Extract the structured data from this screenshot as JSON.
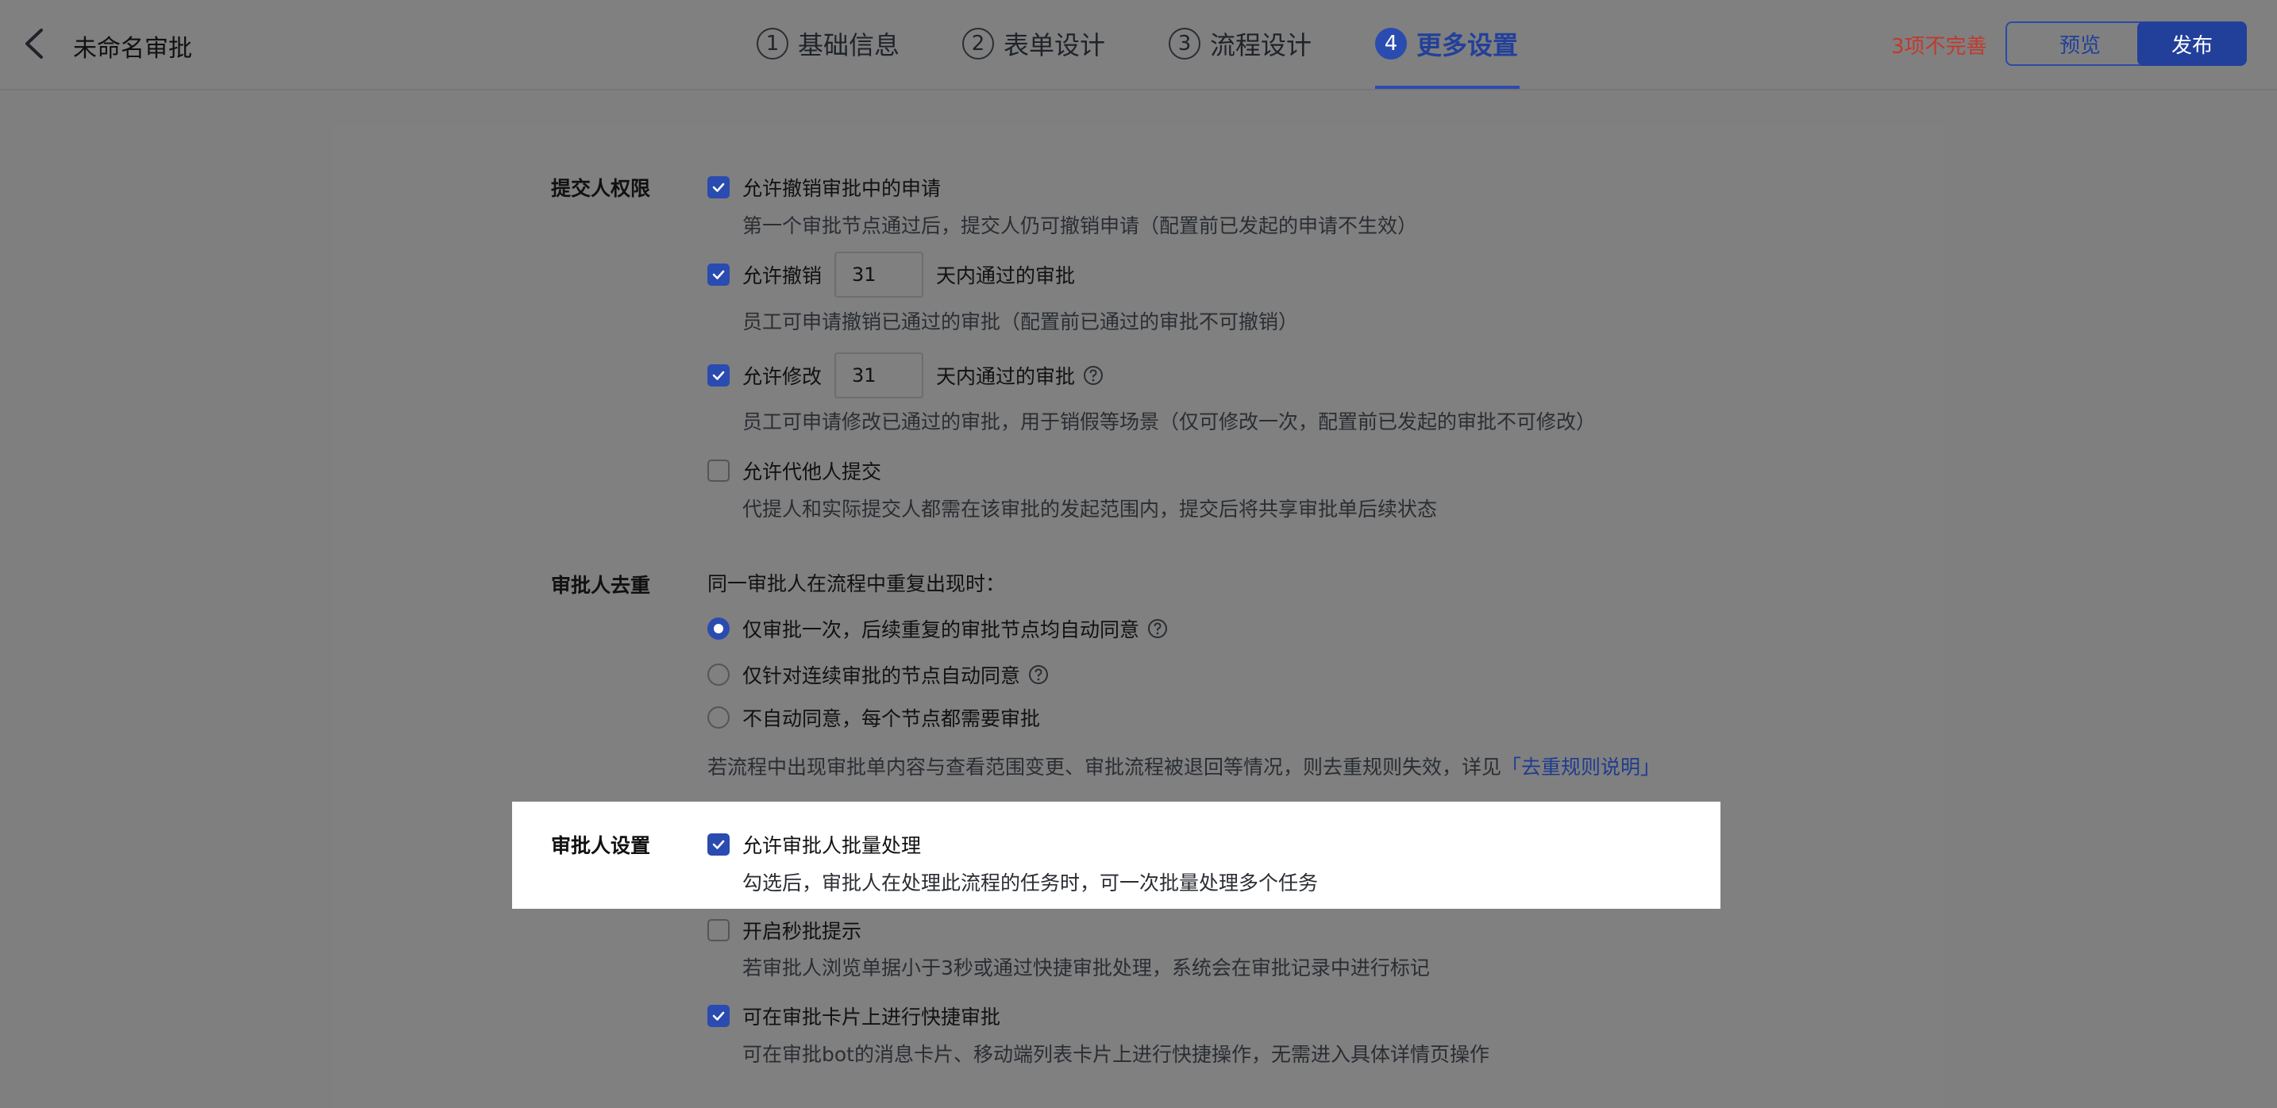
{
  "header": {
    "title": "未命名审批",
    "steps": [
      {
        "num": "1",
        "label": "基础信息"
      },
      {
        "num": "2",
        "label": "表单设计"
      },
      {
        "num": "3",
        "label": "流程设计"
      },
      {
        "num": "4",
        "label": "更多设置"
      }
    ],
    "active_step": 4,
    "incomplete": "3项不完善",
    "preview": "预览",
    "publish": "发布"
  },
  "submitter": {
    "section": "提交人权限",
    "options": [
      {
        "label": "允许撤销审批中的申请",
        "checked": true,
        "desc": "第一个审批节点通过后，提交人仍可撤销申请（配置前已发起的申请不生效）"
      },
      {
        "label": "允许撤销",
        "checked": true,
        "days": "31",
        "suffix": "天内通过的审批",
        "desc": "员工可申请撤销已通过的审批（配置前已通过的审批不可撤销）"
      },
      {
        "label": "允许修改",
        "checked": true,
        "days": "31",
        "suffix": "天内通过的审批",
        "desc": "员工可申请修改已通过的审批，用于销假等场景（仅可修改一次，配置前已发起的审批不可修改）"
      },
      {
        "label": "允许代他人提交",
        "checked": false,
        "desc": "代提人和实际提交人都需在该审批的发起范围内，提交后将共享审批单后续状态"
      }
    ]
  },
  "dedupe": {
    "section": "审批人去重",
    "prompt": "同一审批人在流程中重复出现时：",
    "options": [
      {
        "label": "仅审批一次，后续重复的审批节点均自动同意",
        "selected": true
      },
      {
        "label": "仅针对连续审批的节点自动同意",
        "selected": false
      },
      {
        "label": "不自动同意，每个节点都需要审批",
        "selected": false
      }
    ],
    "note": "若流程中出现审批单内容与查看范围变更、审批流程被退回等情况，则去重规则失效，详见",
    "note_link": "「去重规则说明」"
  },
  "approver": {
    "section": "审批人设置",
    "options": [
      {
        "label": "允许审批人批量处理",
        "checked": true,
        "desc": "勾选后，审批人在处理此流程的任务时，可一次批量处理多个任务"
      },
      {
        "label": "开启秒批提示",
        "checked": false,
        "desc": "若审批人浏览单据小于3秒或通过快捷审批处理，系统会在审批记录中进行标记"
      },
      {
        "label": "可在审批卡片上进行快捷审批",
        "checked": true,
        "desc": "可在审批bot的消息卡片、移动端列表卡片上进行快捷操作，无需进入具体详情页操作"
      }
    ]
  },
  "colors": {
    "accent": "#2a4bb0",
    "warning": "#c03a2e",
    "overlay": "#808080"
  }
}
